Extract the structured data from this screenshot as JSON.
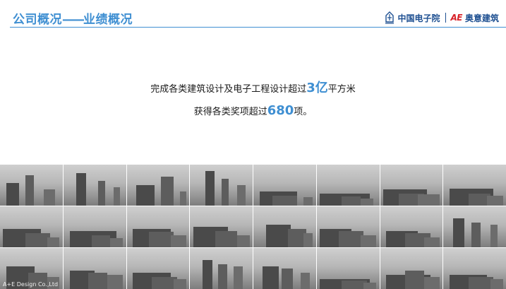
{
  "header": {
    "title_main": "公司概况",
    "title_dash": "——",
    "title_sub": "业绩概况",
    "brand_cec": "中国电子院",
    "brand_ae_logo": "AE",
    "brand_ae": "奥意建筑"
  },
  "summary": {
    "line1_pre": "完成各类建筑设计及电子工程设计超过",
    "line1_num": "3亿",
    "line1_post": "平方米",
    "line2_pre": "获得各类奖项超过",
    "line2_num": "680",
    "line2_post": "项。"
  },
  "photos": {
    "count": 24,
    "tone": "grayscale",
    "watermark": "A+E Design Co.,Ltd"
  },
  "colors": {
    "accent": "#3f8fd2",
    "brand_blue": "#1d4f91",
    "brand_red": "#d8232a"
  }
}
